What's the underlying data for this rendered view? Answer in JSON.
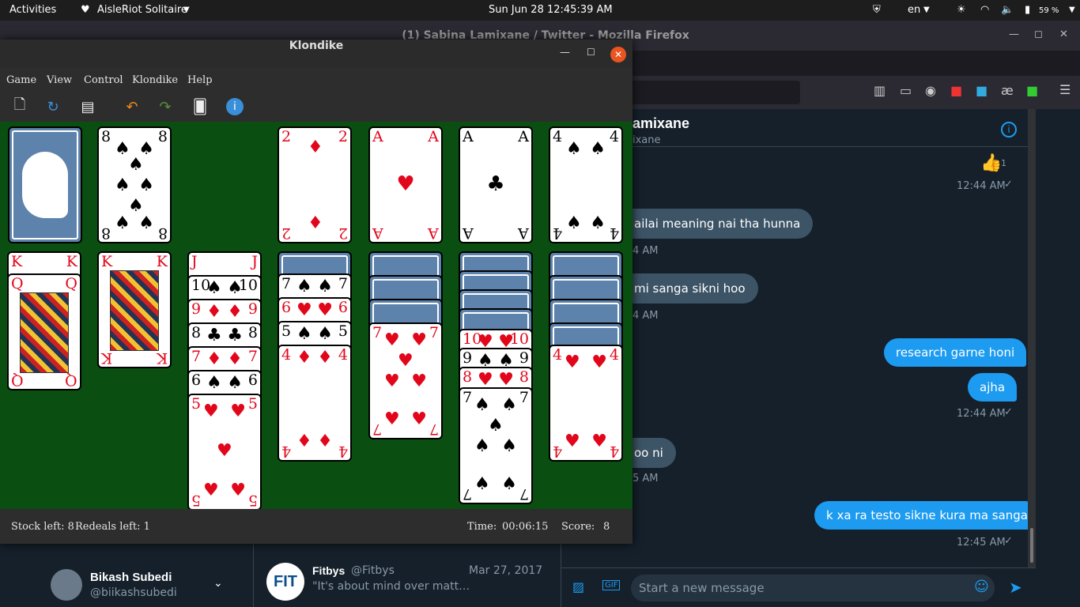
{
  "topbar": {
    "activities": "Activities",
    "app": "AisleRiot Solitaire",
    "clock": "Sun Jun 28  12:45:39 AM",
    "lang": "en",
    "battery": "59 %"
  },
  "firefox": {
    "title": "(1) Sabina Lamixane / Twitter - Mozilla Firefox"
  },
  "window": {
    "title": "Klondike"
  },
  "menu": [
    "Game",
    "View",
    "Control",
    "Klondike",
    "Help"
  ],
  "status": {
    "stock": "Stock left: 8",
    "redeals": "Redeals left: 1",
    "time_label": "Time:",
    "time": "00:06:15",
    "score_label": "Score:",
    "score": "8"
  },
  "cards": {
    "waste": "8",
    "f1": "2",
    "f2": "A",
    "f3": "A",
    "f4": "4",
    "t1a": "K",
    "t1b": "Q",
    "t2": "K",
    "t3a": "J",
    "t3b": "10",
    "t3c": "9",
    "t3d": "8",
    "t3e": "7",
    "t3f": "6",
    "t3g": "5",
    "t4a": "7",
    "t4b": "6",
    "t4c": "5",
    "t4d": "4",
    "t5": "7",
    "t6a": "10",
    "t6b": "9",
    "t6c": "8",
    "t6d": "7",
    "t7": "4"
  },
  "suits": {
    "spade": "♠",
    "heart": "♥",
    "diamond": "♦",
    "club": "♣"
  },
  "dm": {
    "name": "amixane",
    "handle": "ixane",
    "reaction": "1",
    "messages": [
      {
        "dir": "in",
        "text": "ailai meaning nai tha hunna",
        "time": "4 AM"
      },
      {
        "dir": "in",
        "text": "mi sanga sikni hoo",
        "time": "4 AM"
      },
      {
        "dir": "out",
        "text": "research garne honi"
      },
      {
        "dir": "out",
        "text": "ajha",
        "time": "12:44 AM"
      },
      {
        "dir": "in",
        "text": "oo ni",
        "time": "5 AM"
      },
      {
        "dir": "out",
        "text": "k xa ra testo sikne kura ma sanga",
        "time": "12:45 AM"
      }
    ],
    "first_time": "12:44 AM",
    "compose_placeholder": "Start a new message"
  },
  "tweet": {
    "user": "Fitbys",
    "handle": "@Fitbys",
    "date": "Mar 27, 2017",
    "text": "\"It's about mind over matt…"
  },
  "account": {
    "name": "Bikash Subedi",
    "handle": "@biikashsubedi"
  }
}
